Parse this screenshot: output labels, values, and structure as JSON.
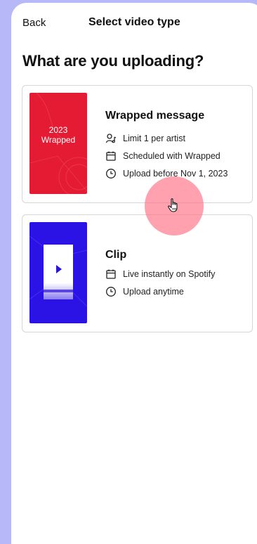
{
  "header": {
    "back_label": "Back",
    "title": "Select video type"
  },
  "main": {
    "heading": "What are you uploading?"
  },
  "cards": {
    "wrapped": {
      "thumb_line1": "2023",
      "thumb_line2": "Wrapped",
      "title": "Wrapped message",
      "features": [
        {
          "icon": "person-music-icon",
          "text": "Limit 1 per artist"
        },
        {
          "icon": "calendar-icon",
          "text": "Scheduled with Wrapped"
        },
        {
          "icon": "clock-icon",
          "text": "Upload before Nov 1, 2023"
        }
      ]
    },
    "clip": {
      "title": "Clip",
      "features": [
        {
          "icon": "calendar-icon",
          "text": "Live instantly on Spotify"
        },
        {
          "icon": "clock-icon",
          "text": "Upload anytime"
        }
      ]
    }
  },
  "colors": {
    "background": "#b7b8f7",
    "wrapped_red": "#e51b34",
    "clip_blue": "#2b13e6",
    "cursor_highlight": "#ff6e82"
  }
}
